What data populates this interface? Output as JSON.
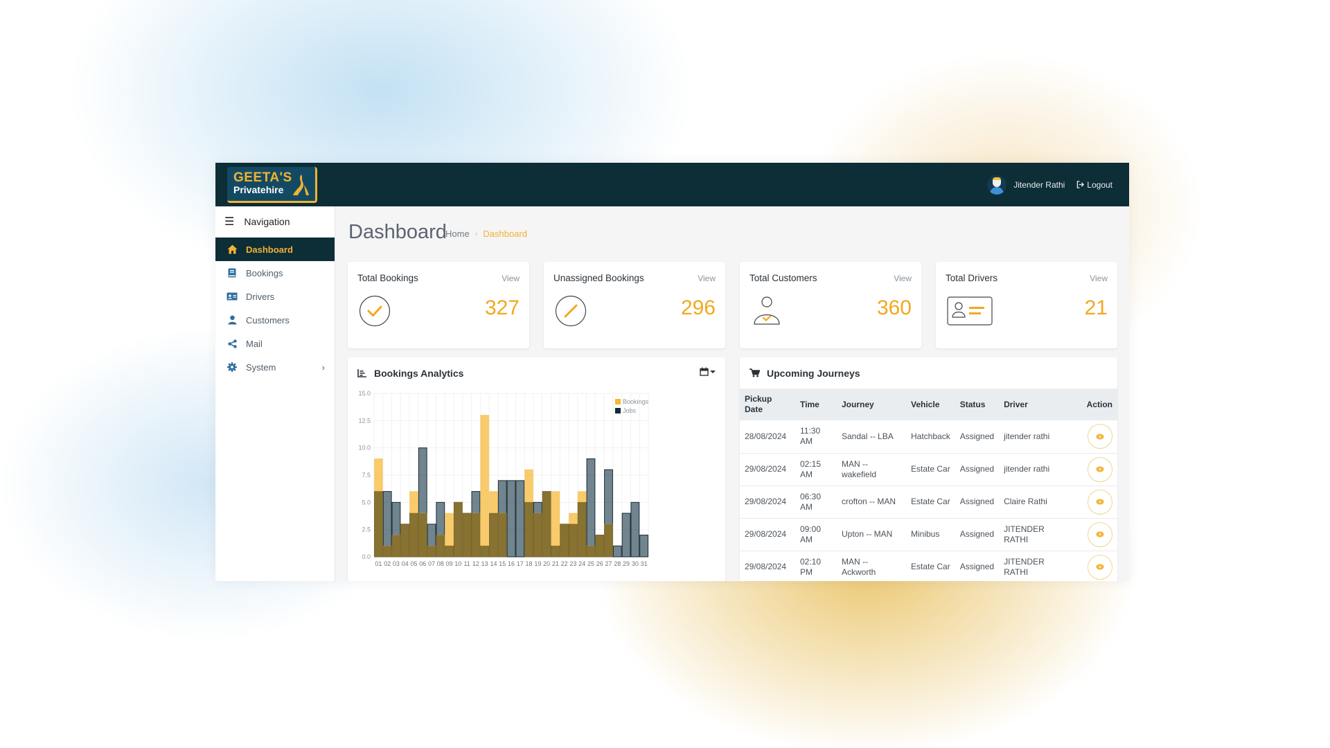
{
  "header": {
    "logo_line1": "GEETA'S",
    "logo_line2": "Privatehire",
    "user_name": "Jitender Rathi",
    "logout_label": "Logout"
  },
  "sidebar": {
    "title": "Navigation",
    "items": [
      {
        "label": "Dashboard",
        "icon": "home-icon",
        "active": true
      },
      {
        "label": "Bookings",
        "icon": "book-icon"
      },
      {
        "label": "Drivers",
        "icon": "id-card-icon"
      },
      {
        "label": "Customers",
        "icon": "user-icon"
      },
      {
        "label": "Mail",
        "icon": "share-icon"
      },
      {
        "label": "System",
        "icon": "gear-icon",
        "has_submenu": true
      }
    ]
  },
  "page": {
    "title": "Dashboard",
    "breadcrumb": [
      "Home",
      "Dashboard"
    ]
  },
  "stats": [
    {
      "title": "Total Bookings",
      "view_label": "View",
      "value": "327",
      "icon": "check-circle-icon"
    },
    {
      "title": "Unassigned Bookings",
      "view_label": "View",
      "value": "296",
      "icon": "slash-circle-icon"
    },
    {
      "title": "Total Customers",
      "view_label": "View",
      "value": "360",
      "icon": "user-check-icon"
    },
    {
      "title": "Total Drivers",
      "view_label": "View",
      "value": "21",
      "icon": "driver-card-icon"
    }
  ],
  "colors": {
    "brand_dark": "#0d2d37",
    "accent": "#f2a81d",
    "bookings": "#f7b731",
    "jobs": "#1a3a4a"
  },
  "analytics": {
    "title": "Bookings Analytics"
  },
  "chart_data": {
    "type": "bar",
    "title": "Bookings Analytics",
    "xlabel": "",
    "ylabel": "",
    "ylim": [
      0,
      15
    ],
    "yticks": [
      "0.0",
      "2.5",
      "5.0",
      "7.5",
      "10.0",
      "12.5",
      "15.0"
    ],
    "grid": true,
    "legend": "top-right",
    "categories": [
      "01",
      "02",
      "03",
      "04",
      "05",
      "06",
      "07",
      "08",
      "09",
      "10",
      "11",
      "12",
      "13",
      "14",
      "15",
      "16",
      "17",
      "18",
      "19",
      "20",
      "21",
      "22",
      "23",
      "24",
      "25",
      "26",
      "27",
      "28",
      "29",
      "30",
      "31"
    ],
    "series": [
      {
        "name": "Bookings",
        "values": [
          9,
          1,
          2,
          3,
          6,
          4,
          1,
          2,
          4,
          5,
          4,
          4,
          13,
          6,
          4,
          0,
          0,
          8,
          4,
          6,
          6,
          3,
          4,
          6,
          1,
          2,
          3,
          0,
          0,
          0,
          0
        ]
      },
      {
        "name": "Jobs",
        "values": [
          6,
          6,
          5,
          3,
          4,
          10,
          3,
          5,
          1,
          5,
          4,
          6,
          1,
          4,
          7,
          7,
          7,
          5,
          5,
          6,
          1,
          3,
          3,
          5,
          9,
          2,
          8,
          1,
          4,
          5,
          2
        ]
      }
    ]
  },
  "journeys": {
    "title": "Upcoming Journeys",
    "columns": [
      "Pickup Date",
      "Time",
      "Journey",
      "Vehicle",
      "Status",
      "Driver",
      "Action"
    ],
    "rows": [
      {
        "date": "28/08/2024",
        "time": "11:30 AM",
        "journey": "Sandal -- LBA",
        "vehicle": "Hatchback",
        "status": "Assigned",
        "driver": "jitender rathi"
      },
      {
        "date": "29/08/2024",
        "time": "02:15 AM",
        "journey": "MAN -- wakefield",
        "vehicle": "Estate Car",
        "status": "Assigned",
        "driver": "jitender rathi"
      },
      {
        "date": "29/08/2024",
        "time": "06:30 AM",
        "journey": "crofton -- MAN",
        "vehicle": "Estate Car",
        "status": "Assigned",
        "driver": "Claire Rathi"
      },
      {
        "date": "29/08/2024",
        "time": "09:00 AM",
        "journey": "Upton -- MAN",
        "vehicle": "Minibus",
        "status": "Assigned",
        "driver": "JITENDER RATHI"
      },
      {
        "date": "29/08/2024",
        "time": "02:10 PM",
        "journey": "MAN -- Ackworth",
        "vehicle": "Estate Car",
        "status": "Assigned",
        "driver": "JITENDER RATHI"
      }
    ]
  }
}
